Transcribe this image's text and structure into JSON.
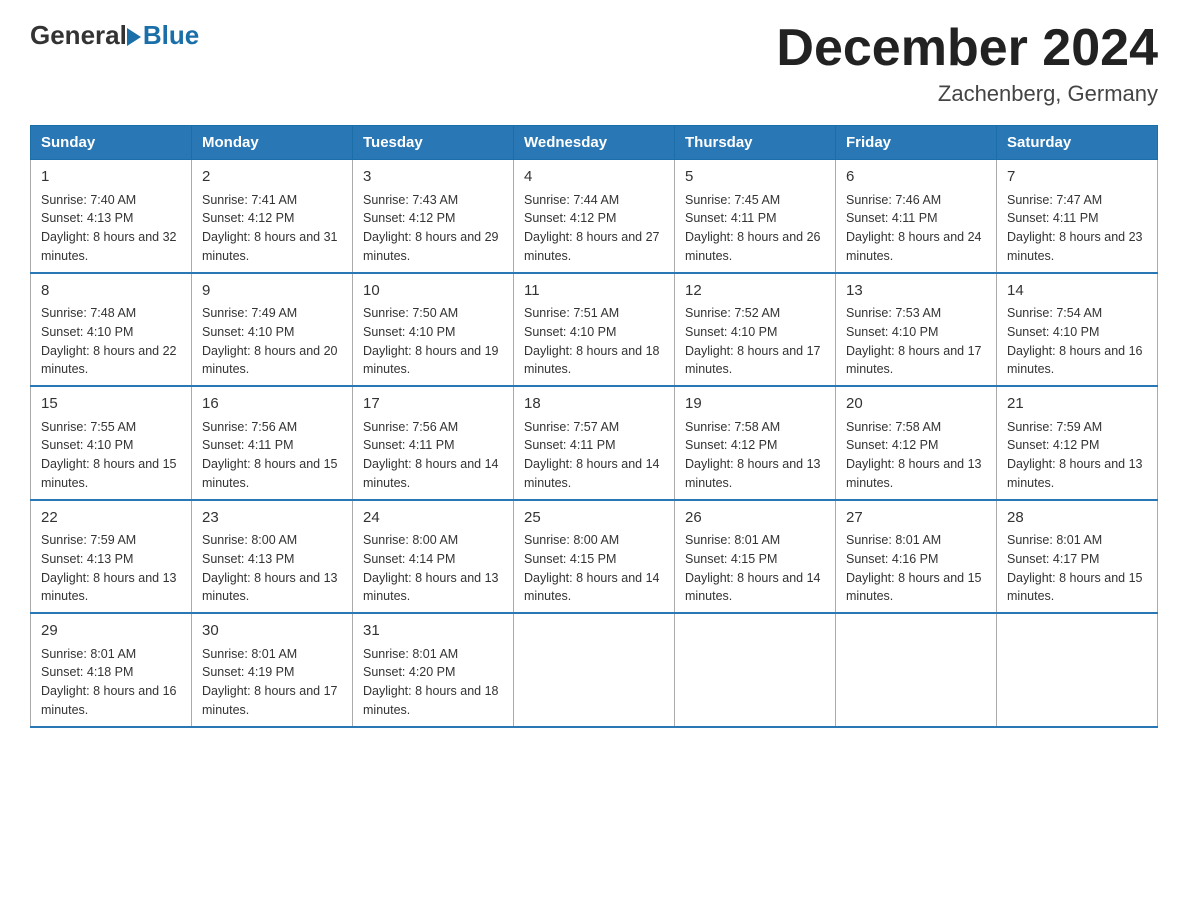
{
  "logo": {
    "general": "General",
    "blue": "Blue"
  },
  "title": "December 2024",
  "location": "Zachenberg, Germany",
  "days_of_week": [
    "Sunday",
    "Monday",
    "Tuesday",
    "Wednesday",
    "Thursday",
    "Friday",
    "Saturday"
  ],
  "weeks": [
    [
      {
        "day": "1",
        "sunrise": "7:40 AM",
        "sunset": "4:13 PM",
        "daylight": "8 hours and 32 minutes."
      },
      {
        "day": "2",
        "sunrise": "7:41 AM",
        "sunset": "4:12 PM",
        "daylight": "8 hours and 31 minutes."
      },
      {
        "day": "3",
        "sunrise": "7:43 AM",
        "sunset": "4:12 PM",
        "daylight": "8 hours and 29 minutes."
      },
      {
        "day": "4",
        "sunrise": "7:44 AM",
        "sunset": "4:12 PM",
        "daylight": "8 hours and 27 minutes."
      },
      {
        "day": "5",
        "sunrise": "7:45 AM",
        "sunset": "4:11 PM",
        "daylight": "8 hours and 26 minutes."
      },
      {
        "day": "6",
        "sunrise": "7:46 AM",
        "sunset": "4:11 PM",
        "daylight": "8 hours and 24 minutes."
      },
      {
        "day": "7",
        "sunrise": "7:47 AM",
        "sunset": "4:11 PM",
        "daylight": "8 hours and 23 minutes."
      }
    ],
    [
      {
        "day": "8",
        "sunrise": "7:48 AM",
        "sunset": "4:10 PM",
        "daylight": "8 hours and 22 minutes."
      },
      {
        "day": "9",
        "sunrise": "7:49 AM",
        "sunset": "4:10 PM",
        "daylight": "8 hours and 20 minutes."
      },
      {
        "day": "10",
        "sunrise": "7:50 AM",
        "sunset": "4:10 PM",
        "daylight": "8 hours and 19 minutes."
      },
      {
        "day": "11",
        "sunrise": "7:51 AM",
        "sunset": "4:10 PM",
        "daylight": "8 hours and 18 minutes."
      },
      {
        "day": "12",
        "sunrise": "7:52 AM",
        "sunset": "4:10 PM",
        "daylight": "8 hours and 17 minutes."
      },
      {
        "day": "13",
        "sunrise": "7:53 AM",
        "sunset": "4:10 PM",
        "daylight": "8 hours and 17 minutes."
      },
      {
        "day": "14",
        "sunrise": "7:54 AM",
        "sunset": "4:10 PM",
        "daylight": "8 hours and 16 minutes."
      }
    ],
    [
      {
        "day": "15",
        "sunrise": "7:55 AM",
        "sunset": "4:10 PM",
        "daylight": "8 hours and 15 minutes."
      },
      {
        "day": "16",
        "sunrise": "7:56 AM",
        "sunset": "4:11 PM",
        "daylight": "8 hours and 15 minutes."
      },
      {
        "day": "17",
        "sunrise": "7:56 AM",
        "sunset": "4:11 PM",
        "daylight": "8 hours and 14 minutes."
      },
      {
        "day": "18",
        "sunrise": "7:57 AM",
        "sunset": "4:11 PM",
        "daylight": "8 hours and 14 minutes."
      },
      {
        "day": "19",
        "sunrise": "7:58 AM",
        "sunset": "4:12 PM",
        "daylight": "8 hours and 13 minutes."
      },
      {
        "day": "20",
        "sunrise": "7:58 AM",
        "sunset": "4:12 PM",
        "daylight": "8 hours and 13 minutes."
      },
      {
        "day": "21",
        "sunrise": "7:59 AM",
        "sunset": "4:12 PM",
        "daylight": "8 hours and 13 minutes."
      }
    ],
    [
      {
        "day": "22",
        "sunrise": "7:59 AM",
        "sunset": "4:13 PM",
        "daylight": "8 hours and 13 minutes."
      },
      {
        "day": "23",
        "sunrise": "8:00 AM",
        "sunset": "4:13 PM",
        "daylight": "8 hours and 13 minutes."
      },
      {
        "day": "24",
        "sunrise": "8:00 AM",
        "sunset": "4:14 PM",
        "daylight": "8 hours and 13 minutes."
      },
      {
        "day": "25",
        "sunrise": "8:00 AM",
        "sunset": "4:15 PM",
        "daylight": "8 hours and 14 minutes."
      },
      {
        "day": "26",
        "sunrise": "8:01 AM",
        "sunset": "4:15 PM",
        "daylight": "8 hours and 14 minutes."
      },
      {
        "day": "27",
        "sunrise": "8:01 AM",
        "sunset": "4:16 PM",
        "daylight": "8 hours and 15 minutes."
      },
      {
        "day": "28",
        "sunrise": "8:01 AM",
        "sunset": "4:17 PM",
        "daylight": "8 hours and 15 minutes."
      }
    ],
    [
      {
        "day": "29",
        "sunrise": "8:01 AM",
        "sunset": "4:18 PM",
        "daylight": "8 hours and 16 minutes."
      },
      {
        "day": "30",
        "sunrise": "8:01 AM",
        "sunset": "4:19 PM",
        "daylight": "8 hours and 17 minutes."
      },
      {
        "day": "31",
        "sunrise": "8:01 AM",
        "sunset": "4:20 PM",
        "daylight": "8 hours and 18 minutes."
      },
      null,
      null,
      null,
      null
    ]
  ],
  "labels": {
    "sunrise": "Sunrise:",
    "sunset": "Sunset:",
    "daylight": "Daylight:"
  }
}
